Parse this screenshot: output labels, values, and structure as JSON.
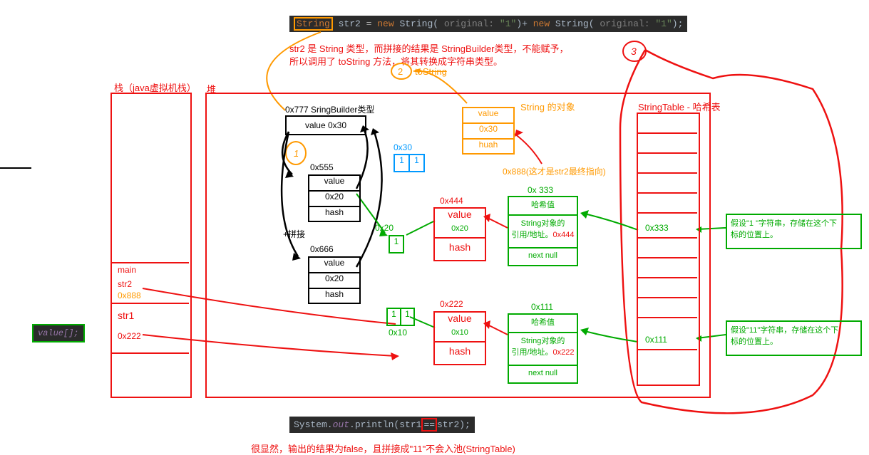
{
  "code_top": {
    "kw": "String",
    "id": "str2",
    "eq": " = ",
    "kw2": "new",
    "call": " String(",
    "orig": " original: ",
    "s1": "\"1\"",
    "plus": ")+ ",
    "kw3": "new",
    "call2": " String(",
    "orig2": " original: ",
    "s2": "\"1\"",
    "end": ");"
  },
  "comment_top1": "str2 是 String 类型，而拼接的结果是 StringBuilder类型，不能赋予，",
  "comment_top2": "所以调用了 toString 方法，将其转换成字符串类型。",
  "toString": "toString",
  "num2": "2",
  "num3": "3",
  "num1": "1",
  "stack_title": "栈（java虚拟机栈）",
  "heap_title": "堆",
  "stringtable_title": "StringTable - 哈希表",
  "sb_label": "0x777 SringBuilder类型",
  "sb_val": "value 0x30",
  "addr555": "0x555",
  "box555_val": "value",
  "box555_addr": "0x20",
  "box555_hash": "hash",
  "addr666": "0x666",
  "box666_val": "value",
  "box666_addr": "0x20",
  "box666_hash": "hash",
  "concat": "+拼接",
  "addr030": "0x30",
  "one": "1",
  "addr020": "0x20",
  "addr010": "0x10",
  "addr444": "0x444",
  "box444_val": "value",
  "box444_addr": "0x20",
  "box444_hash": "hash",
  "addr222": "0x222",
  "box222_val": "value",
  "box222_addr": "0x10",
  "box222_hash": "hash",
  "string_obj": "String 的对象",
  "so_val": "value",
  "so_addr": "0x30",
  "so_hash": "huah",
  "addr888": "0x888(这才是str2最终指向)",
  "addr333": "0x 333",
  "g333_hash": "哈希值",
  "g333_ref": "String对象的",
  "g333_ref2": "引用/地址。",
  "g333_refaddr": "0x444",
  "g333_next": "next null",
  "addr111": "0x111",
  "g111_hash": "哈希值",
  "g111_ref": "String对象的",
  "g111_ref2": "引用/地址。",
  "g111_refaddr": "0x222",
  "g111_next": "next null",
  "tbl333": "0x333",
  "tbl111": "0x111",
  "tip1a": "假设\"1 \"字符串，存储在这个下",
  "tip1b": "标的位置上。",
  "tip2a": "假设\"11\"字符串，存储在这个下",
  "tip2b": "标的位置上。",
  "stack_main": "main",
  "stack_str2": "str2",
  "stack_str2addr": "0x888",
  "stack_str1": "str1",
  "stack_str1addr": "0x222",
  "value_snip": "value[];",
  "code_bot_pre": "System.",
  "code_bot_out": "out",
  "code_bot_call": ".println(str1",
  "code_bot_eq": "==",
  "code_bot_end": "str2);",
  "bottom_note": "很显然，输出的结果为false，且拼接成\"11\"不会入池(StringTable)"
}
